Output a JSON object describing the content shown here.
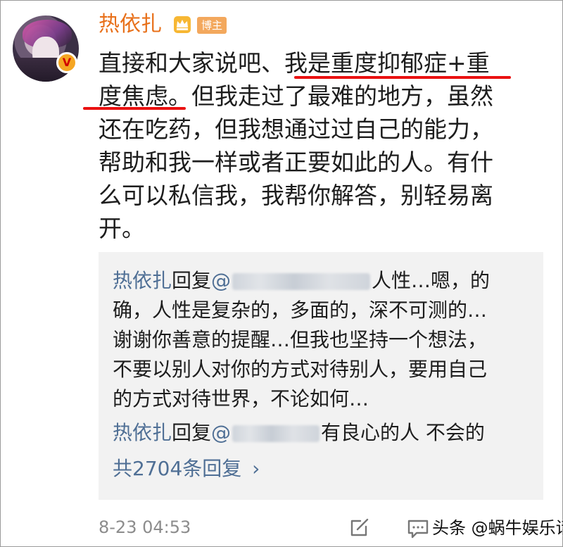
{
  "user": {
    "name": "热依扎",
    "badge": "博主",
    "verified_mark": "V"
  },
  "post": {
    "lines": [
      "直接和大家说吧、我是重度抑郁症+重",
      "度焦虑。但我走过了最难的地方，虽然",
      "还在吃药，但我想通过过自己的能力，",
      "帮助和我一样或者正要如此的人。有什",
      "么可以私信我，我帮你解答，别轻易离",
      "开。"
    ]
  },
  "replies": {
    "reply1": {
      "name": "热依扎",
      "verb": "回复",
      "at": "@",
      "rest_line1": "人性…嗯，的",
      "lines": [
        "确，人性是复杂的，多面的，深不可测的…",
        "谢谢你善意的提醒…但我也坚持一个想法，",
        "不要以别人对你的方式对待别人，要用自己",
        "的方式对待世界，不论如何…"
      ]
    },
    "reply2": {
      "name": "热依扎",
      "verb": "回复",
      "at": "@",
      "text": "有良心的人 不会的"
    },
    "more_label": "共2704条回复",
    "more_arrow": "›"
  },
  "footer": {
    "timestamp": "8-23 04:53",
    "watermark": "头条 @蜗牛娱乐话"
  },
  "icons": {
    "crown": "crown-icon",
    "edit": "edit-icon",
    "comment": "comment-icon"
  },
  "colors": {
    "username": "#e8701a",
    "reply_name": "#4f6f95",
    "highlight_underline": "#ea1111",
    "badge_bg": "#f3a85d"
  }
}
